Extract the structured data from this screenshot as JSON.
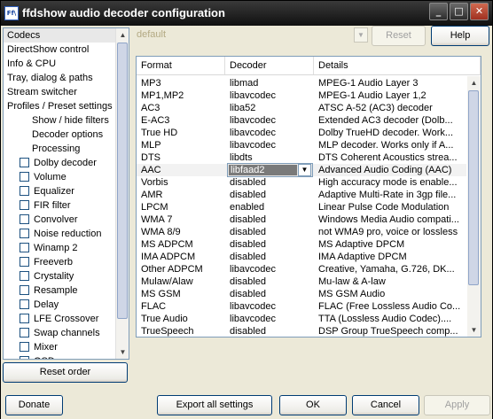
{
  "window": {
    "title": "ffdshow audio decoder configuration",
    "app_icon_text": "Ff\\"
  },
  "titlebar_buttons": {
    "minimize": "_",
    "maximize": "□",
    "close": "✕"
  },
  "tree": {
    "items": [
      {
        "label": "Codecs",
        "checkbox": false,
        "indent": 0,
        "selected": true
      },
      {
        "label": "DirectShow control",
        "checkbox": false,
        "indent": 0
      },
      {
        "label": "Info & CPU",
        "checkbox": false,
        "indent": 0
      },
      {
        "label": "Tray, dialog & paths",
        "checkbox": false,
        "indent": 0
      },
      {
        "label": "Stream switcher",
        "checkbox": false,
        "indent": 0
      },
      {
        "label": "Profiles / Preset settings",
        "checkbox": false,
        "indent": 0
      },
      {
        "label": "Show / hide filters",
        "checkbox": false,
        "indent": 2
      },
      {
        "label": "Decoder options",
        "checkbox": false,
        "indent": 2
      },
      {
        "label": "Processing",
        "checkbox": false,
        "indent": 2
      },
      {
        "label": "Dolby decoder",
        "checkbox": true,
        "indent": 1
      },
      {
        "label": "Volume",
        "checkbox": true,
        "indent": 1
      },
      {
        "label": "Equalizer",
        "checkbox": true,
        "indent": 1
      },
      {
        "label": "FIR filter",
        "checkbox": true,
        "indent": 1
      },
      {
        "label": "Convolver",
        "checkbox": true,
        "indent": 1
      },
      {
        "label": "Noise reduction",
        "checkbox": true,
        "indent": 1
      },
      {
        "label": "Winamp 2",
        "checkbox": true,
        "indent": 1
      },
      {
        "label": "Freeverb",
        "checkbox": true,
        "indent": 1
      },
      {
        "label": "Crystality",
        "checkbox": true,
        "indent": 1
      },
      {
        "label": "Resample",
        "checkbox": true,
        "indent": 1
      },
      {
        "label": "Delay",
        "checkbox": true,
        "indent": 1
      },
      {
        "label": "LFE Crossover",
        "checkbox": true,
        "indent": 1
      },
      {
        "label": "Swap channels",
        "checkbox": true,
        "indent": 1
      },
      {
        "label": "Mixer",
        "checkbox": true,
        "indent": 1
      },
      {
        "label": "OSD",
        "checkbox": true,
        "indent": 1
      }
    ]
  },
  "preset": {
    "value": "default",
    "reset_label": "Reset",
    "help_label": "Help"
  },
  "table": {
    "headers": [
      "Format",
      "Decoder",
      "Details"
    ],
    "rows": [
      {
        "format": "MP3",
        "decoder": "libmad",
        "details": "MPEG-1 Audio Layer 3"
      },
      {
        "format": "MP1,MP2",
        "decoder": "libavcodec",
        "details": "MPEG-1 Audio Layer 1,2"
      },
      {
        "format": "AC3",
        "decoder": "liba52",
        "details": "ATSC A-52 (AC3) decoder"
      },
      {
        "format": "E-AC3",
        "decoder": "libavcodec",
        "details": "Extended AC3 decoder (Dolb..."
      },
      {
        "format": "True HD",
        "decoder": "libavcodec",
        "details": "Dolby TrueHD decoder. Work..."
      },
      {
        "format": "MLP",
        "decoder": "libavcodec",
        "details": "MLP decoder. Works only if A..."
      },
      {
        "format": "DTS",
        "decoder": "libdts",
        "details": "DTS Coherent Acoustics strea..."
      },
      {
        "format": "AAC",
        "decoder": "libfaad2",
        "details": "Advanced Audio Coding (AAC)",
        "selected": true
      },
      {
        "format": "Vorbis",
        "decoder": "disabled",
        "details": "High accuracy mode is enable..."
      },
      {
        "format": "AMR",
        "decoder": "disabled",
        "details": "Adaptive Multi-Rate in 3gp file..."
      },
      {
        "format": "LPCM",
        "decoder": "enabled",
        "details": "Linear Pulse Code Modulation"
      },
      {
        "format": "WMA 7",
        "decoder": "disabled",
        "details": "Windows Media Audio compati..."
      },
      {
        "format": "WMA 8/9",
        "decoder": "disabled",
        "details": "not WMA9 pro, voice or lossless"
      },
      {
        "format": "MS ADPCM",
        "decoder": "disabled",
        "details": "MS Adaptive DPCM"
      },
      {
        "format": "IMA ADPCM",
        "decoder": "disabled",
        "details": "IMA Adaptive DPCM"
      },
      {
        "format": "Other ADPCM",
        "decoder": "libavcodec",
        "details": "Creative, Yamaha, G.726, DK..."
      },
      {
        "format": "Mulaw/Alaw",
        "decoder": "disabled",
        "details": "Mu-law & A-law"
      },
      {
        "format": "MS GSM",
        "decoder": "disabled",
        "details": "MS GSM Audio"
      },
      {
        "format": "FLAC",
        "decoder": "libavcodec",
        "details": "FLAC (Free Lossless Audio Co..."
      },
      {
        "format": "True Audio",
        "decoder": "libavcodec",
        "details": "TTA (Lossless Audio Codec)...."
      },
      {
        "format": "TrueSpeech",
        "decoder": "disabled",
        "details": "DSP Group TrueSpeech comp..."
      }
    ]
  },
  "buttons": {
    "reset_order": "Reset order",
    "donate": "Donate",
    "export_all": "Export all settings",
    "ok": "OK",
    "cancel": "Cancel",
    "apply": "Apply"
  }
}
